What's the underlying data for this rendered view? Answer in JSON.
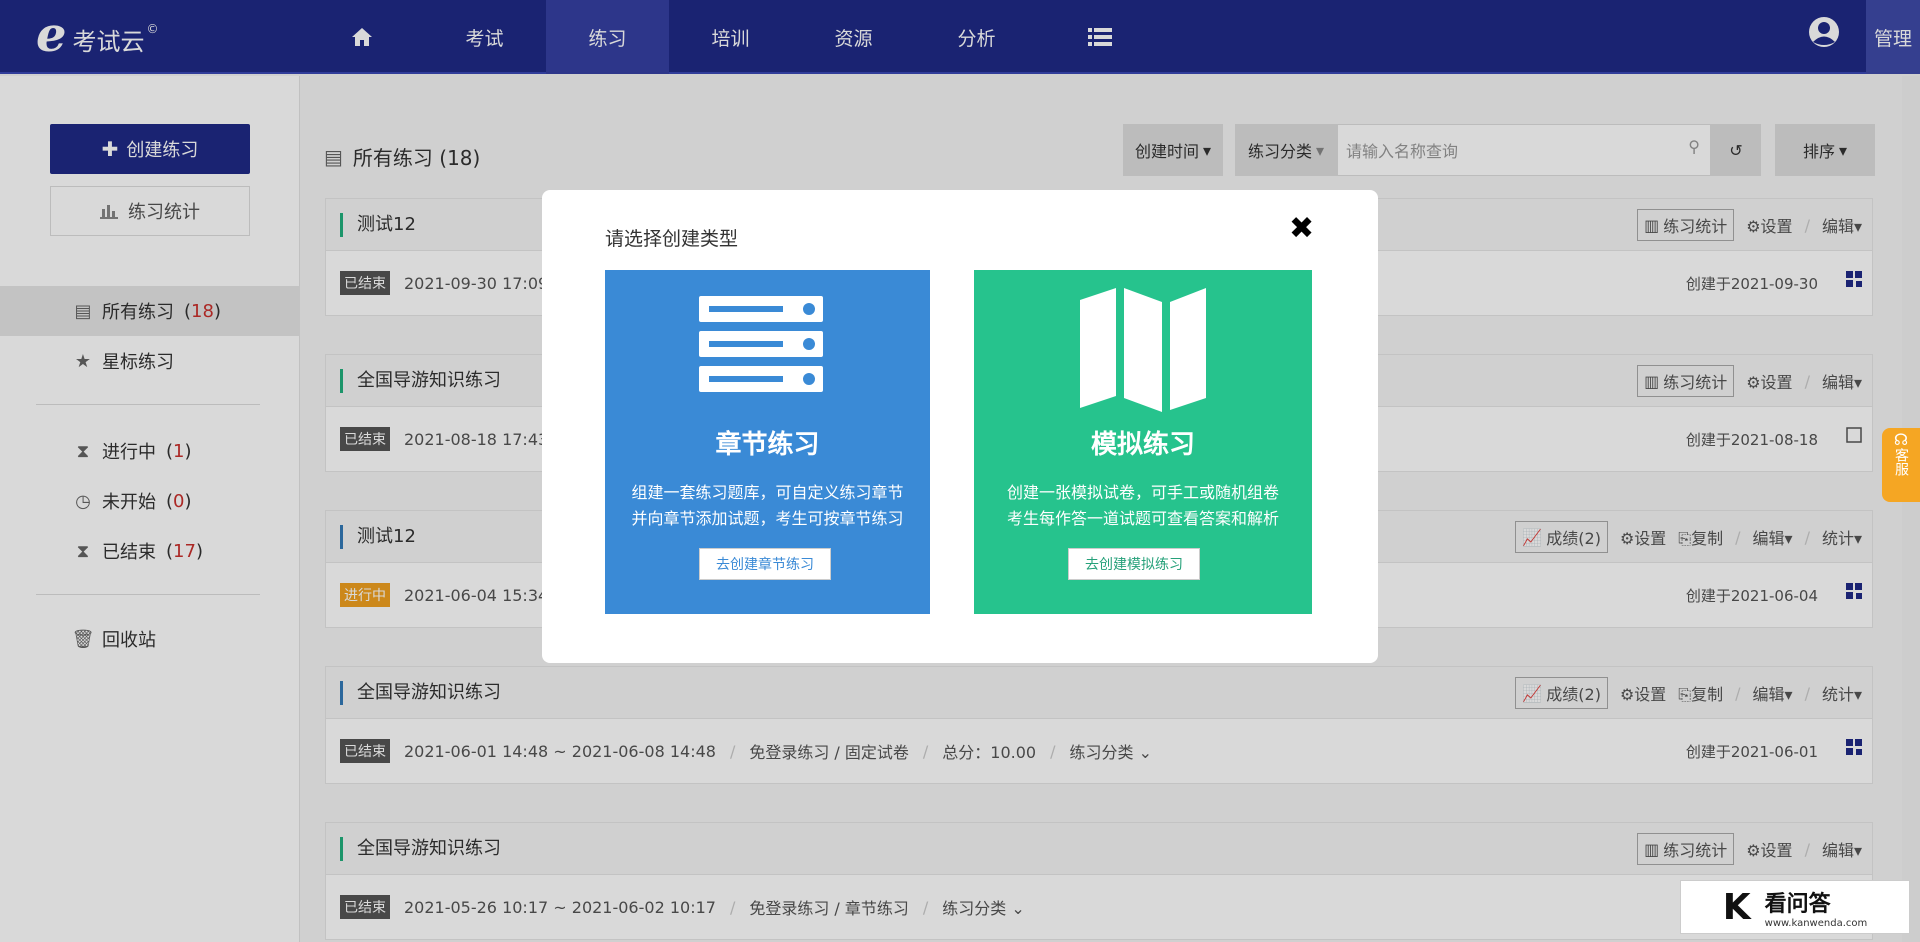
{
  "header": {
    "logo_text": "考试云",
    "logo_mark": "©",
    "nav": [
      {
        "label": "",
        "icon": "home-icon"
      },
      {
        "label": "考试"
      },
      {
        "label": "练习",
        "active": true
      },
      {
        "label": "培训"
      },
      {
        "label": "资源"
      },
      {
        "label": "分析"
      },
      {
        "label": "",
        "icon": "list-icon"
      }
    ],
    "admin_label": "管理"
  },
  "sidebar": {
    "create_label": "创建练习",
    "stats_label": "练习统计",
    "items": [
      {
        "label": "所有练习",
        "count": "18"
      },
      {
        "label": "星标练习"
      },
      {
        "label": "进行中",
        "count": "1"
      },
      {
        "label": "未开始",
        "count": "0"
      },
      {
        "label": "已结束",
        "count": "17"
      },
      {
        "label": "回收站"
      }
    ]
  },
  "main": {
    "title": "所有练习 (18)",
    "filter_time": "创建时间",
    "filter_category": "练习分类",
    "search_placeholder": "请输入名称查询",
    "sort_label": "排序",
    "cards": [
      {
        "title": "测试12",
        "status": "已结束",
        "date": "2021-09-30 17:09 ~",
        "created": "创建于2021-09-30",
        "actions": [
          "练习统计",
          "设置",
          "编辑"
        ]
      },
      {
        "title": "全国导游知识练习",
        "status": "已结束",
        "date": "2021-08-18 17:43 ~",
        "created": "创建于2021-08-18",
        "actions": [
          "练习统计",
          "设置",
          "编辑"
        ]
      },
      {
        "title": "测试12",
        "status": "进行中",
        "date": "2021-06-04 15:34 ~",
        "created": "创建于2021-06-04",
        "actions": [
          "成绩(2)",
          "设置",
          "复制",
          "编辑",
          "统计"
        ]
      },
      {
        "title": "全国导游知识练习",
        "status": "已结束",
        "date": "2021-06-01 14:48 ~ 2021-06-08 14:48",
        "mode": "免登录练习 / 固定试卷",
        "score": "总分：10.00",
        "category": "练习分类",
        "created": "创建于2021-06-01",
        "actions": [
          "成绩(2)",
          "设置",
          "复制",
          "编辑",
          "统计"
        ]
      },
      {
        "title": "全国导游知识练习",
        "status": "已结束",
        "date": "2021-05-26 10:17 ~ 2021-06-02 10:17",
        "mode": "免登录练习 / 章节练习",
        "category": "练习分类",
        "actions": [
          "练习统计",
          "设置",
          "编辑"
        ]
      }
    ]
  },
  "modal": {
    "title": "请选择创建类型",
    "close": "✖",
    "options": [
      {
        "title": "章节练习",
        "desc1": "组建一套练习题库，可自定义练习章节",
        "desc2": "并向章节添加试题，考生可按章节练习",
        "button": "去创建章节练习",
        "color": "#3a8ad6"
      },
      {
        "title": "模拟练习",
        "desc1": "创建一张模拟试卷，可手工或随机组卷",
        "desc2": "考生每作答一道试题可查看答案和解析",
        "button": "去创建模拟练习",
        "color": "#26c38d"
      }
    ]
  },
  "service_tab": "客服",
  "watermark": {
    "main": "看问答",
    "sub": "www.kanwenda.com"
  }
}
